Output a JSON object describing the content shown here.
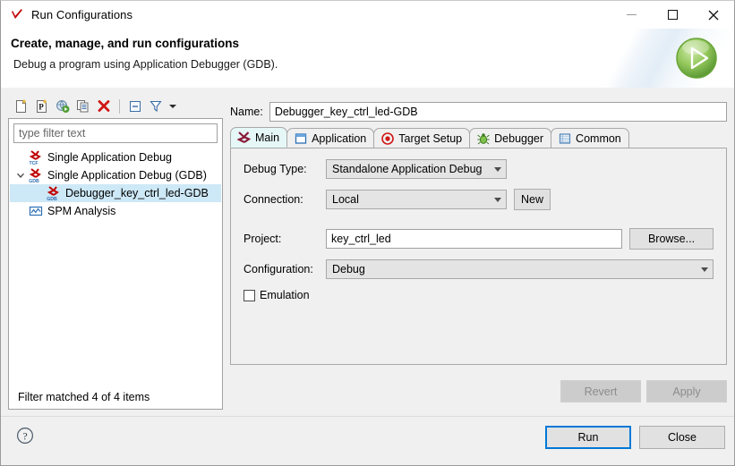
{
  "window": {
    "title": "Run Configurations",
    "icon": "run-config-icon",
    "controls": {
      "minimize": "minimize-icon",
      "maximize": "maximize-icon",
      "close": "close-icon"
    }
  },
  "header": {
    "title": "Create, manage, and run configurations",
    "subtitle": "Debug a program using Application Debugger (GDB).",
    "badge_icon": "green-run-arrow"
  },
  "left": {
    "toolbar": [
      {
        "name": "new-configuration-icon",
        "title": "New launch configuration"
      },
      {
        "name": "new-prototype-icon",
        "title": "New prototype"
      },
      {
        "name": "export-icon",
        "title": "Export"
      },
      {
        "name": "duplicate-icon",
        "title": "Duplicate"
      },
      {
        "name": "delete-icon",
        "title": "Delete"
      },
      {
        "name": "collapse-all-icon",
        "title": "Collapse All"
      },
      {
        "name": "filter-icon",
        "title": "Filter"
      },
      {
        "name": "view-menu-icon",
        "title": "View Menu"
      }
    ],
    "filter_placeholder": "type filter text",
    "filter_value": "",
    "tree": [
      {
        "label": "Single Application Debug",
        "icon": "tcf-debug-icon",
        "indent": 1,
        "expandable": false,
        "selected": false
      },
      {
        "label": "Single Application Debug (GDB)",
        "icon": "gdb-debug-icon",
        "indent": 1,
        "expandable": true,
        "expanded": true,
        "selected": false
      },
      {
        "label": "Debugger_key_ctrl_led-GDB",
        "icon": "gdb-debug-icon",
        "indent": 2,
        "expandable": false,
        "selected": true
      },
      {
        "label": "SPM Analysis",
        "icon": "spm-analysis-icon",
        "indent": 1,
        "expandable": false,
        "selected": false
      }
    ],
    "status": "Filter matched 4 of 4 items"
  },
  "right": {
    "name_label": "Name:",
    "name_value": "Debugger_key_ctrl_led-GDB",
    "tabs": [
      {
        "label": "Main",
        "icon": "main-tab-icon",
        "active": true
      },
      {
        "label": "Application",
        "icon": "application-tab-icon",
        "active": false
      },
      {
        "label": "Target Setup",
        "icon": "target-setup-icon",
        "active": false
      },
      {
        "label": "Debugger",
        "icon": "debugger-bug-icon",
        "active": false
      },
      {
        "label": "Common",
        "icon": "common-tab-icon",
        "active": false
      }
    ],
    "form": {
      "debug_type_label": "Debug Type:",
      "debug_type_value": "Standalone Application Debug",
      "connection_label": "Connection:",
      "connection_value": "Local",
      "new_button": "New",
      "project_label": "Project:",
      "project_value": "key_ctrl_led",
      "browse_button": "Browse...",
      "configuration_label": "Configuration:",
      "configuration_value": "Debug",
      "emulation_label": "Emulation",
      "emulation_checked": false
    },
    "revert_button": "Revert",
    "apply_button": "Apply"
  },
  "footer": {
    "help_icon": "help-question-icon",
    "run_button": "Run",
    "close_button": "Close"
  },
  "colors": {
    "accent": "#0078d7",
    "selection": "#cde8f6",
    "active_tab": "#e6f7f7",
    "chrome": "#f0f0f0",
    "run_green": "#76b947"
  }
}
